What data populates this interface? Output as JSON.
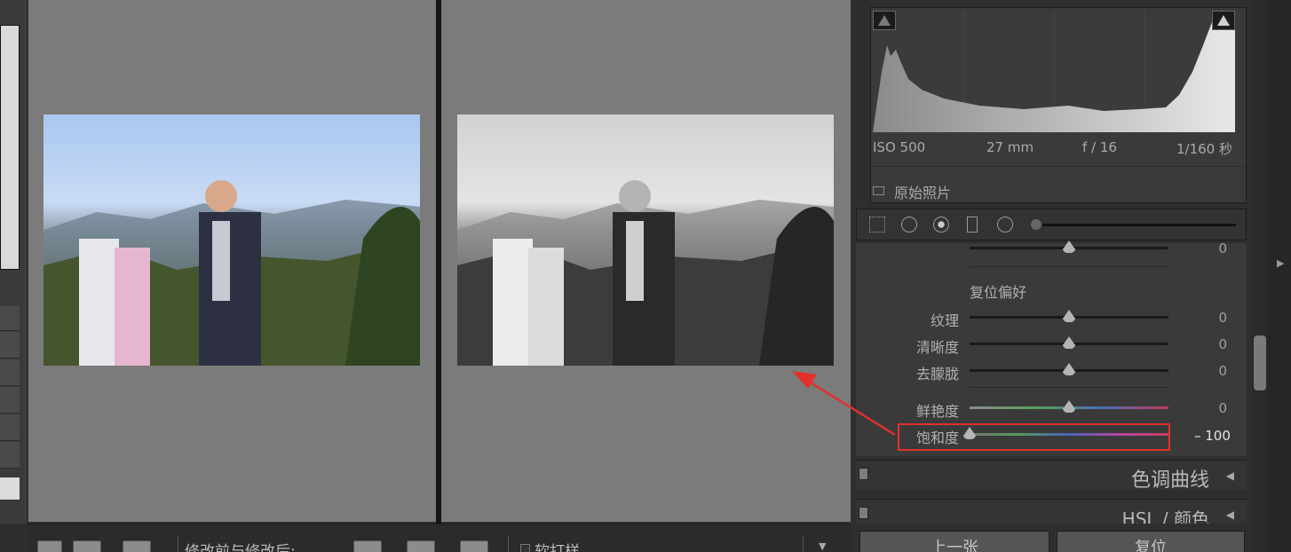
{
  "toolbar": {
    "compare_label": "修改前与修改后:",
    "proof_label": "软打样"
  },
  "histogram": {
    "iso": "ISO 500",
    "focal": "27 mm",
    "aperture": "f / 16",
    "shutter": "1/160 秒",
    "original_photo": "原始照片"
  },
  "basic": {
    "section_title": "复位偏好",
    "rows": [
      {
        "label": "纹理",
        "value": "0",
        "level": 0.5
      },
      {
        "label": "清晰度",
        "value": "0",
        "level": 0.5
      },
      {
        "label": "去朦胧",
        "value": "0",
        "level": 0.5
      },
      {
        "label": "鲜艳度",
        "value": "0",
        "level": 0.5
      },
      {
        "label": "饱和度",
        "value": "– 100",
        "level": 0.0
      }
    ],
    "top_row_value": "0"
  },
  "sections": {
    "tone_curve": "色调曲线",
    "hsl": "HSL / 颜色"
  },
  "buttons": {
    "previous": "上一张",
    "reset": "复位"
  },
  "colors": {
    "highlight": "#e2302b",
    "panel": "#3a3a3a",
    "canvas": "#7b7b7b"
  }
}
